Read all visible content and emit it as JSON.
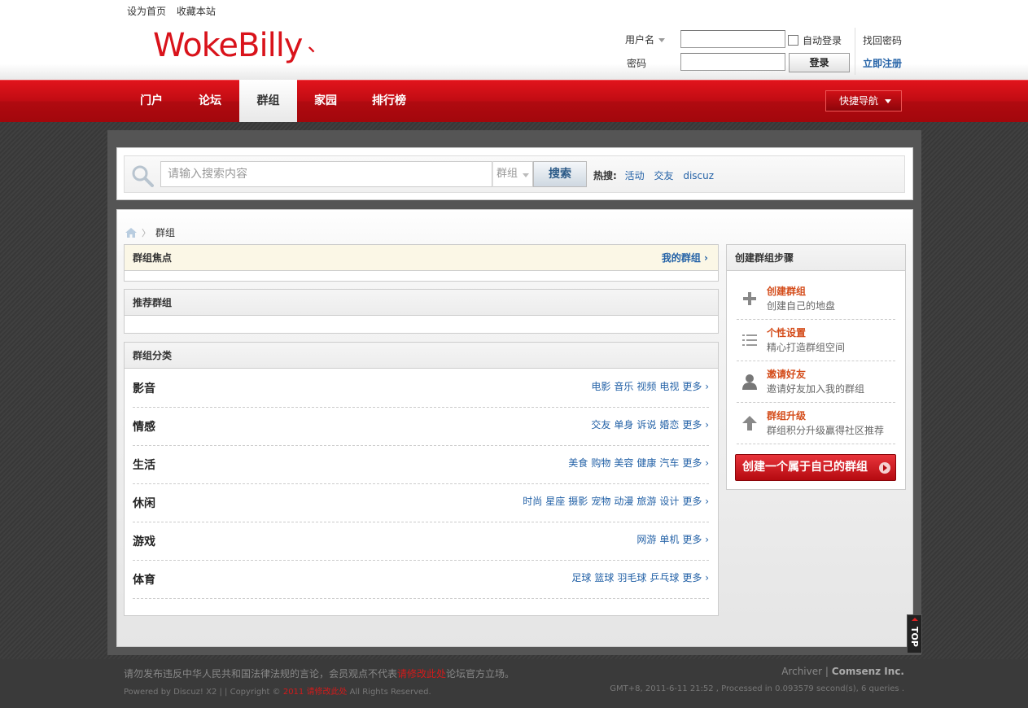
{
  "top_links": [
    "设为首页",
    "收藏本站"
  ],
  "logo": {
    "text": "WokeBilly",
    "mark": "、"
  },
  "login": {
    "username_label": "用户名",
    "password_label": "密码",
    "username_value": "",
    "password_value": "",
    "auto_login": "自动登录",
    "login_button": "登录",
    "find_password": "找回密码",
    "register": "立即注册"
  },
  "nav": {
    "items": [
      {
        "label": "门户"
      },
      {
        "label": "论坛"
      },
      {
        "label": "群组",
        "active": true
      },
      {
        "label": "家园"
      },
      {
        "label": "排行榜"
      }
    ],
    "quick_nav": "快捷导航"
  },
  "search": {
    "placeholder": "请输入搜索内容",
    "type": "群组",
    "button": "搜索",
    "hot_label": "热搜:",
    "hot_keywords": [
      "活动",
      "交友",
      "discuz"
    ]
  },
  "breadcrumb": {
    "current": "群组"
  },
  "panels": {
    "focus": {
      "title": "群组焦点",
      "more": "我的群组 ›"
    },
    "recommend": {
      "title": "推荐群组"
    },
    "category": {
      "title": "群组分类"
    }
  },
  "categories": [
    {
      "name": "影音",
      "links": [
        "电影",
        "音乐",
        "视频",
        "电视",
        "更多 ›"
      ]
    },
    {
      "name": "情感",
      "links": [
        "交友",
        "单身",
        "诉说",
        "婚恋",
        "更多 ›"
      ]
    },
    {
      "name": "生活",
      "links": [
        "美食",
        "购物",
        "美容",
        "健康",
        "汽车",
        "更多 ›"
      ]
    },
    {
      "name": "休闲",
      "links": [
        "时尚",
        "星座",
        "摄影",
        "宠物",
        "动漫",
        "旅游",
        "设计",
        "更多 ›"
      ]
    },
    {
      "name": "游戏",
      "links": [
        "网游",
        "单机",
        "更多 ›"
      ]
    },
    {
      "name": "体育",
      "links": [
        "足球",
        "篮球",
        "羽毛球",
        "乒乓球",
        "更多 ›"
      ]
    }
  ],
  "side": {
    "title": "创建群组步骤",
    "steps": [
      {
        "title": "创建群组",
        "desc": "创建自己的地盘",
        "icon": "plus-icon"
      },
      {
        "title": "个性设置",
        "desc": "精心打造群组空间",
        "icon": "list-icon"
      },
      {
        "title": "邀请好友",
        "desc": "邀请好友加入我的群组",
        "icon": "user-icon"
      },
      {
        "title": "群组升级",
        "desc": "群组积分升级赢得社区推荐",
        "icon": "arrow-up-icon"
      }
    ],
    "create_button": "创建一个属于自己的群组"
  },
  "footer": {
    "notice_pre": "请勿发布违反中华人民共和国法律法规的言论，会员观点不代表",
    "notice_red": "请修改此处",
    "notice_post": "论坛官方立场。",
    "powered": "Powered by Discuz! X2 | | Copyright ©",
    "powered_red": "2011 请修改此处",
    "powered_post": "All Rights Reserved.",
    "archiver": "Archiver",
    "sep": "|",
    "company": "Comsenz Inc.",
    "process": "GMT+8, 2011-6-11 21:52 , Processed in 0.093579 second(s), 6 queries ."
  },
  "top_button": "TOP",
  "colors": {
    "brand_red": "#d9131b",
    "link_blue": "#2462a7",
    "step_orange": "#d44c1a"
  }
}
